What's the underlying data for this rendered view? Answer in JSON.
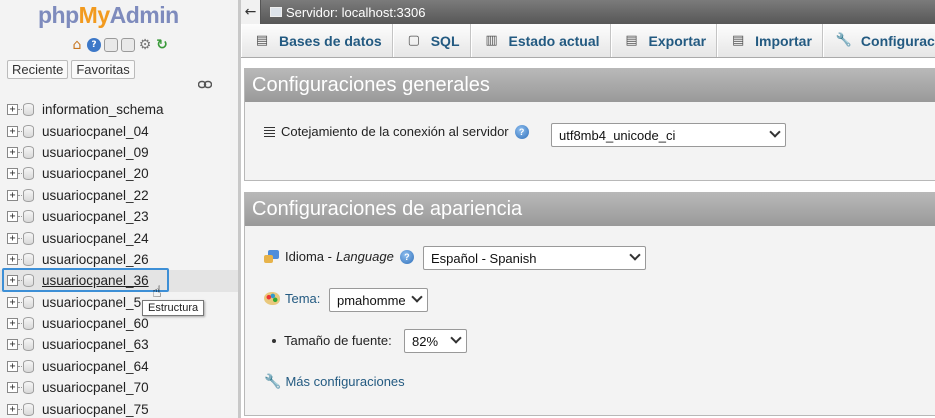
{
  "logo": {
    "php": "php",
    "my": "My",
    "admin": "Admin"
  },
  "nav": {
    "icons": [
      "home-icon",
      "help-icon",
      "docs-icon",
      "docs-sql-icon",
      "settings-gear-icon",
      "reload-icon"
    ],
    "tabs": [
      "Reciente",
      "Favoritas"
    ],
    "databases": [
      "information_schema",
      "usuariocpanel_04",
      "usuariocpanel_09",
      "usuariocpanel_20",
      "usuariocpanel_22",
      "usuariocpanel_23",
      "usuariocpanel_24",
      "usuariocpanel_26",
      "usuariocpanel_36",
      "usuariocpanel_5",
      "usuariocpanel_60",
      "usuariocpanel_63",
      "usuariocpanel_64",
      "usuariocpanel_70",
      "usuariocpanel_75"
    ],
    "highlighted_index": 8,
    "tooltip": "Estructura"
  },
  "topbar": {
    "back": "←",
    "server": "Servidor: localhost:3306"
  },
  "menu": {
    "tabs": [
      {
        "label": "Bases de datos",
        "icon": "database-icon",
        "glyph": "▤"
      },
      {
        "label": "SQL",
        "icon": "sql-icon",
        "glyph": "▢"
      },
      {
        "label": "Estado actual",
        "icon": "status-chart-icon",
        "glyph": "▥"
      },
      {
        "label": "Exportar",
        "icon": "export-icon",
        "glyph": "▤"
      },
      {
        "label": "Importar",
        "icon": "import-icon",
        "glyph": "▤"
      },
      {
        "label": "Configuración",
        "icon": "wrench-icon",
        "glyph": "🔧"
      }
    ]
  },
  "general": {
    "title": "Configuraciones generales",
    "collation_label": "Cotejamiento de la conexión al servidor",
    "collation_value": "utf8mb4_unicode_ci"
  },
  "appearance": {
    "title": "Configuraciones de apariencia",
    "language_label": "Idioma - ",
    "language_label_en": "Language",
    "language_value": "Español - Spanish",
    "theme_label": "Tema:",
    "theme_value": "pmahomme",
    "fontsize_label": "Tamaño de fuente:",
    "fontsize_value": "82%",
    "more_link": "Más configuraciones"
  }
}
